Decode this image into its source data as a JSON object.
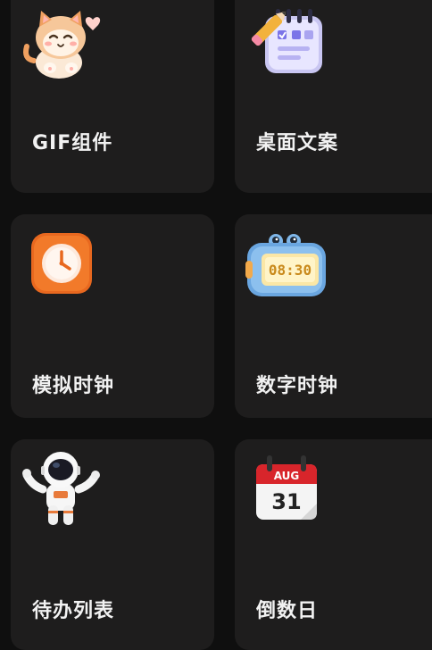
{
  "widgets": [
    {
      "label": "GIF组件",
      "icon": "kitten-icon"
    },
    {
      "label": "桌面文案",
      "icon": "notepad-pencil-icon"
    },
    {
      "label": "模拟时钟",
      "icon": "analog-clock-icon"
    },
    {
      "label": "数字时钟",
      "icon": "digital-clock-icon",
      "display": "08:30"
    },
    {
      "label": "待办列表",
      "icon": "astronaut-icon"
    },
    {
      "label": "倒数日",
      "icon": "calendar-icon",
      "month": "AUG",
      "day": "31"
    }
  ]
}
